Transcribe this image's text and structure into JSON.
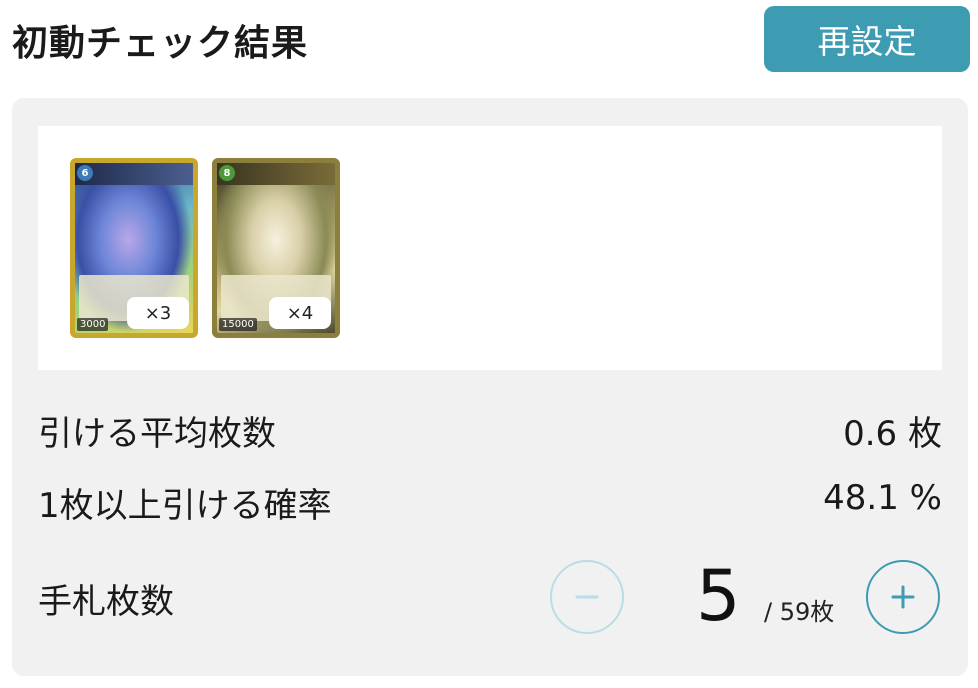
{
  "header": {
    "title": "初動チェック結果",
    "reset_label": "再設定"
  },
  "cards": [
    {
      "cost": "6",
      "power": "3000",
      "quantity": "×3"
    },
    {
      "cost": "8",
      "power": "15000",
      "quantity": "×4"
    }
  ],
  "stats": {
    "average_label": "引ける平均枚数",
    "average_value": "0.6 枚",
    "probability_label": "1枚以上引ける確率",
    "probability_value": "48.1 %"
  },
  "hand": {
    "label": "手札枚数",
    "count": "5",
    "total": "/ 59枚"
  },
  "colors": {
    "accent": "#3d9bb2",
    "panel_bg": "#f1f1f1",
    "minus_disabled": "#b9dde6"
  },
  "icons": {
    "minus": "minus-icon",
    "plus": "plus-icon"
  }
}
